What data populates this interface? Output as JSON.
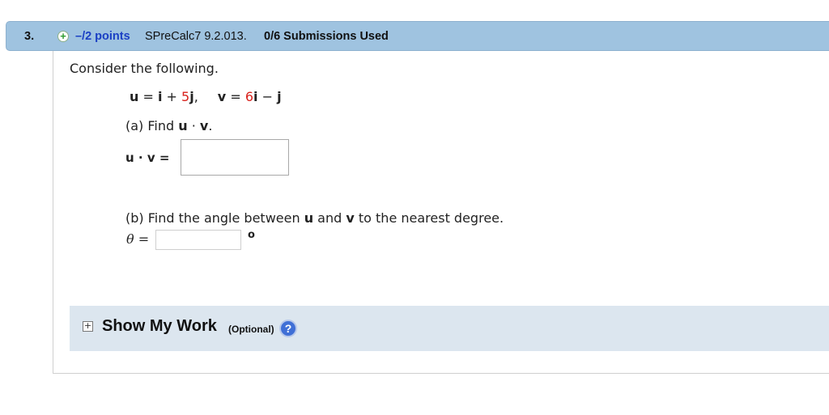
{
  "header": {
    "question_number": "3.",
    "points": "–/2 points",
    "problem_code": "SPreCalc7 9.2.013.",
    "submissions": "0/6 Submissions Used"
  },
  "problem": {
    "intro": "Consider the following.",
    "u_label": "u",
    "u_eq": " = ",
    "u_i": "i",
    "u_plus": " + ",
    "u_coef": "5",
    "u_j": "j",
    "sep": ",",
    "v_label": "v",
    "v_eq": " = ",
    "v_coef": "6",
    "v_i": "i",
    "v_minus": " − ",
    "v_j": "j",
    "part_a_prefix": "(a) Find ",
    "part_a_u": "u",
    "part_a_dot": " · ",
    "part_a_v": "v",
    "part_a_end": ".",
    "answer_a_label": "u · v =",
    "part_b_prefix": "(b) Find the angle between ",
    "part_b_u": "u",
    "part_b_and": " and ",
    "part_b_v": "v",
    "part_b_suffix": " to the nearest degree.",
    "theta_label": "θ =",
    "degree_symbol": "o",
    "answer_a_value": "",
    "answer_b_value": ""
  },
  "show_work": {
    "expand_symbol": "+",
    "title": "Show My Work",
    "optional": "(Optional)",
    "help_symbol": "?"
  }
}
